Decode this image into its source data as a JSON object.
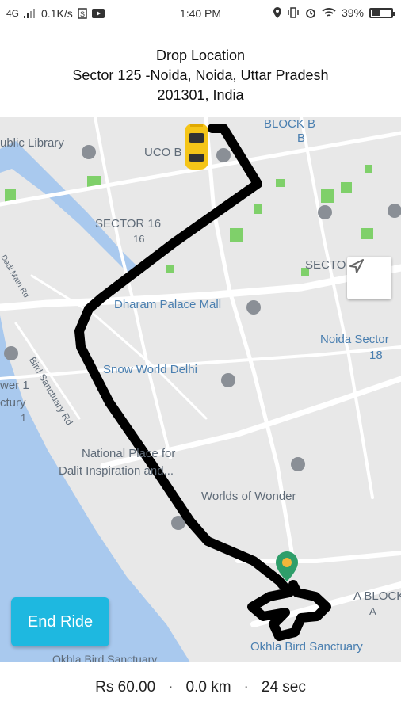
{
  "status_bar": {
    "network": "4G",
    "speed": "0.1K/s",
    "time": "1:40 PM",
    "battery": "39%",
    "battery_level": 0.39
  },
  "header": {
    "title": "Drop Location",
    "address_line1": "Sector 125 -Noida, Noida, Uttar Pradesh",
    "address_line2": "201301, India"
  },
  "map": {
    "labels": {
      "block_b": "BLOCK B",
      "b": "B",
      "public_library": "ublic Library",
      "uco_bank": "UCO B",
      "sector16": "SECTOR 16",
      "sector16_num": "16",
      "sector18": "SECTO",
      "dadi_main": "Dadi Main Rd",
      "dharam_palace": "Dharam Palace Mall",
      "noida_sector": "Noida Sector",
      "noida_num": "18",
      "bird_sanctuary_rd": "Bird Sanctuary Rd",
      "snow_world": "Snow World Delhi",
      "tower1": "wer 1",
      "ctury": "ctury",
      "num1": "1",
      "national_place1": "National Place for",
      "national_place2": "Dalit Inspiration and...",
      "worlds_of_wonder": "Worlds of Wonder",
      "a_block": "A BLOCK",
      "a": "A",
      "okhla_bird": "Okhla Bird Sanctuary",
      "okhla_bird_bottom": "Okhla Bird Sanctuary"
    },
    "colors": {
      "water": "#a9c9ee",
      "park": "#7fd06a",
      "road": "#ffffff",
      "route": "#000000",
      "car": "#f5c518",
      "pin": "#2e9e6a"
    }
  },
  "end_ride_button": "End Ride",
  "footer": {
    "fare": "Rs 60.00",
    "distance": "0.0 km",
    "time": "24 sec"
  }
}
